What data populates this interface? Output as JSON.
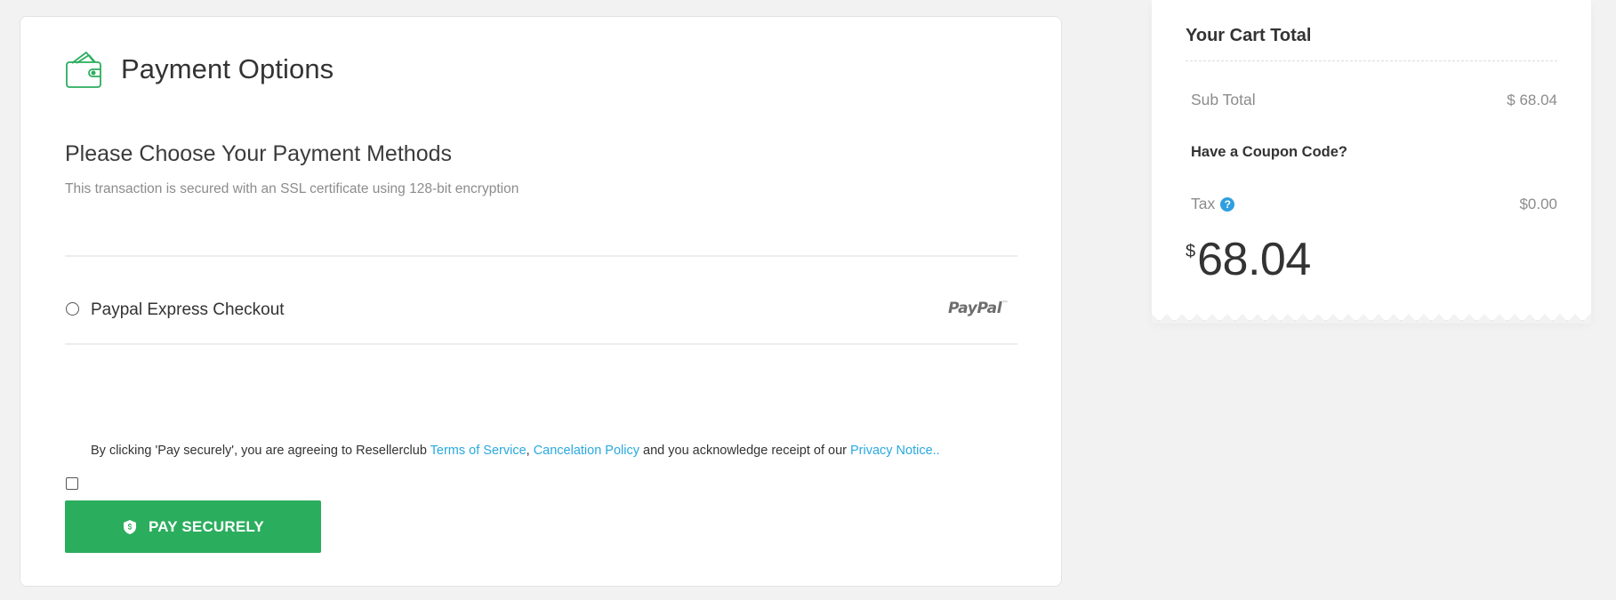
{
  "payment": {
    "title": "Payment Options",
    "methods_heading": "Please Choose Your Payment Methods",
    "ssl_note": "This transaction is secured with an SSL certificate using 128-bit encryption",
    "option_paypal_label": "Paypal Express Checkout",
    "paypal_logo_text": "PayPal",
    "paypal_logo_mark": "™",
    "agreement": {
      "prefix": "By clicking 'Pay securely', you are agreeing to Resellerclub ",
      "terms_link": "Terms of Service",
      "sep": ", ",
      "cancel_link": "Cancelation Policy",
      "middle": " and you acknowledge receipt of our ",
      "privacy_link": "Privacy Notice.."
    },
    "pay_button": "PAY SECURELY"
  },
  "cart": {
    "title": "Your Cart Total",
    "subtotal_label": "Sub Total",
    "subtotal_value": "$ 68.04",
    "coupon_label": "Have a Coupon Code?",
    "tax_label": "Tax",
    "tax_help": "?",
    "tax_value": "$0.00",
    "total_currency": "$",
    "total_amount": "68.04"
  },
  "colors": {
    "accent_green": "#2bad5e",
    "link_blue": "#29a9e0",
    "help_blue": "#2f9fe0"
  },
  "icons": [
    "wallet-icon",
    "shield-icon",
    "help-icon"
  ]
}
